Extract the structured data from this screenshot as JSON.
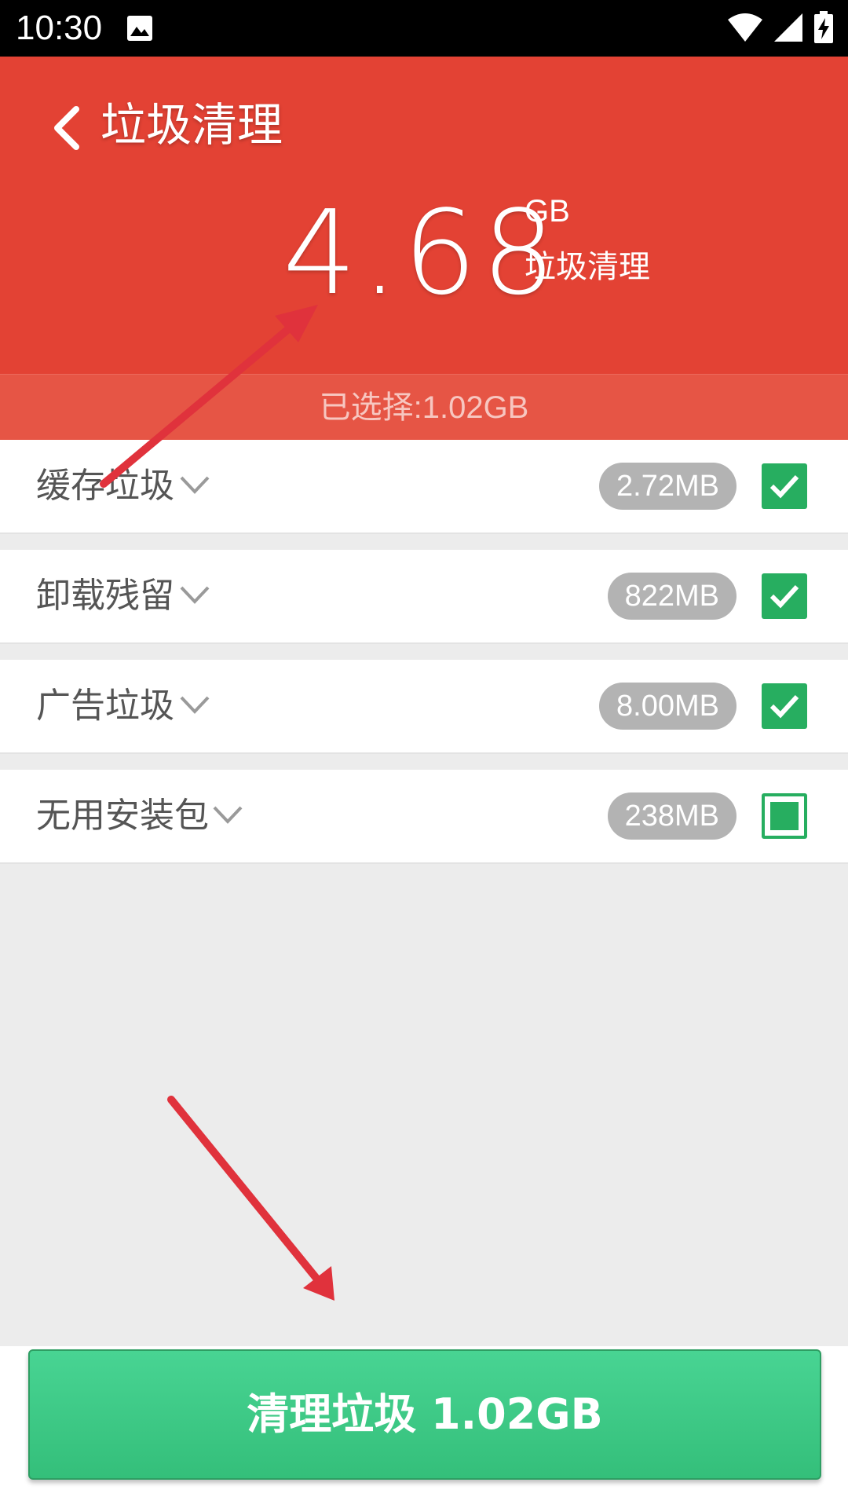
{
  "status_bar": {
    "time": "10:30",
    "icons": [
      "image-icon",
      "wifi-icon",
      "signal-icon",
      "battery-charging-icon"
    ]
  },
  "header": {
    "title": "垃圾清理",
    "back_icon": "chevron-left-icon",
    "total_value": "4.68",
    "total_unit": "GB",
    "total_caption": "垃圾清理",
    "selected": "已选择:1.02GB"
  },
  "items": [
    {
      "label": "缓存垃圾",
      "size": "2.72MB",
      "checked": "full"
    },
    {
      "label": "卸载残留",
      "size": "822MB",
      "checked": "full"
    },
    {
      "label": "广告垃圾",
      "size": "8.00MB",
      "checked": "full"
    },
    {
      "label": "无用安装包",
      "size": "238MB",
      "checked": "partial"
    }
  ],
  "action": {
    "label": "清理垃圾 1.02GB"
  },
  "colors": {
    "header_red": "#e34234",
    "accent_green": "#27ae60",
    "button_green": "#3cc985",
    "annotation_arrow": "#e0323c"
  }
}
